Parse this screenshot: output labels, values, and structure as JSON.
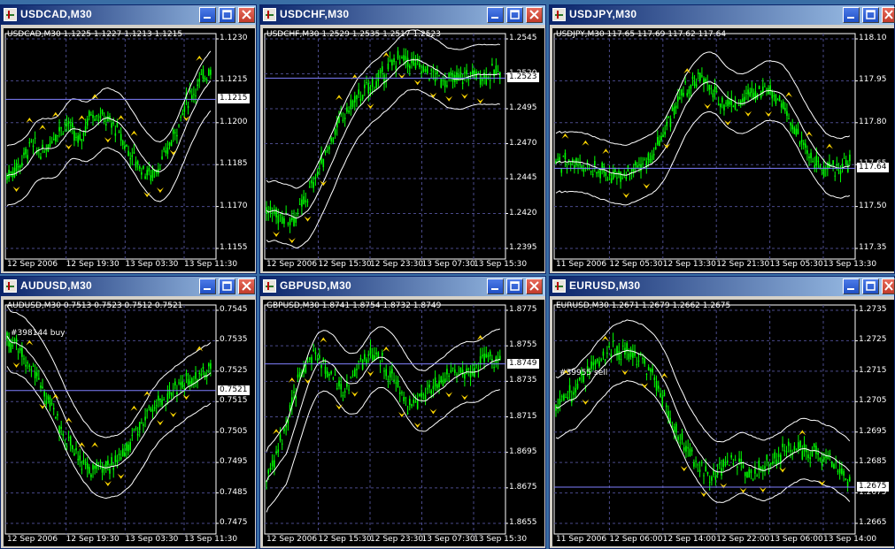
{
  "colors": {
    "background": "#000000",
    "candle": "#00ff00",
    "band": "#ffffff",
    "grid": "#4a4a8a",
    "fractal": "#ffd700",
    "title_bar": "#0a246a"
  },
  "windows": [
    {
      "title": "USDCAD,M30",
      "header": "USDCAD,M30  1.1225 1.1227 1.1213 1.1215",
      "price": "1.1215",
      "note": "",
      "yticks": [
        "1.1230",
        "1.1215",
        "1.1200",
        "1.1185",
        "1.1170",
        "1.1155"
      ],
      "xticks": [
        "12 Sep 2006",
        "12 Sep 19:30",
        "13 Sep 03:30",
        "13 Sep 11:30"
      ],
      "chart_data": {
        "type": "candlestick",
        "symbol": "USDCAD",
        "timeframe": "M30",
        "ylim": [
          1.1147,
          1.1243
        ],
        "last": 1.1215,
        "bar_count": 110
      }
    },
    {
      "title": "USDCHF,M30",
      "header": "USDCHF,M30  1.2529 1.2535 1.2517 1.2523",
      "price": "1.2523",
      "note": "",
      "yticks": [
        "1.2545",
        "1.2520",
        "1.2495",
        "1.2470",
        "1.2445",
        "1.2420",
        "1.2395"
      ],
      "xticks": [
        "12 Sep 2006",
        "12 Sep 15:30",
        "12 Sep 23:30",
        "13 Sep 07:30",
        "13 Sep 15:30"
      ],
      "chart_data": {
        "type": "candlestick",
        "symbol": "USDCHF",
        "timeframe": "M30",
        "ylim": [
          1.2385,
          1.2557
        ],
        "last": 1.2523,
        "bar_count": 120
      }
    },
    {
      "title": "USDJPY,M30",
      "header": "USDJPY,M30  117.65 117.69 117.62 117.64",
      "price": "117.64",
      "note": "",
      "yticks": [
        "118.10",
        "117.95",
        "117.80",
        "117.65",
        "117.50",
        "117.35"
      ],
      "xticks": [
        "11 Sep 2006",
        "12 Sep 05:30",
        "12 Sep 13:30",
        "12 Sep 21:30",
        "13 Sep 05:30",
        "13 Sep 13:30"
      ],
      "chart_data": {
        "type": "candlestick",
        "symbol": "USDJPY",
        "timeframe": "M30",
        "ylim": [
          117.29,
          118.16
        ],
        "last": 117.64,
        "bar_count": 160
      }
    },
    {
      "title": "AUDUSD,M30",
      "header": "AUDUSD,M30  0.7513 0.7523 0.7512 0.7521",
      "price": "0.7521",
      "note": "#398144 buy",
      "yticks": [
        "0.7545",
        "0.7535",
        "0.7525",
        "0.7515",
        "0.7505",
        "0.7495",
        "0.7485",
        "0.7475"
      ],
      "xticks": [
        "12 Sep 2006",
        "12 Sep 19:30",
        "13 Sep 03:30",
        "13 Sep 11:30"
      ],
      "chart_data": {
        "type": "candlestick",
        "symbol": "AUDUSD",
        "timeframe": "M30",
        "ylim": [
          0.7469,
          0.7552
        ],
        "last": 0.7521,
        "bar_count": 110
      }
    },
    {
      "title": "GBPUSD,M30",
      "header": "GBPUSD,M30  1.8741 1.8754 1.8732 1.8749",
      "price": "1.8749",
      "note": "",
      "yticks": [
        "1.8775",
        "1.8755",
        "1.8735",
        "1.8715",
        "1.8695",
        "1.8675",
        "1.8655"
      ],
      "xticks": [
        "12 Sep 2006",
        "12 Sep 15:30",
        "12 Sep 23:30",
        "13 Sep 07:30",
        "13 Sep 15:30"
      ],
      "chart_data": {
        "type": "candlestick",
        "symbol": "GBPUSD",
        "timeframe": "M30",
        "ylim": [
          1.8645,
          1.8785
        ],
        "last": 1.8749,
        "bar_count": 120
      }
    },
    {
      "title": "EURUSD,M30",
      "header": "EURUSD,M30  1.2671 1.2679 1.2662 1.2675",
      "price": "1.2675",
      "note": "#39955 sell",
      "yticks": [
        "1.2735",
        "1.2725",
        "1.2715",
        "1.2705",
        "1.2695",
        "1.2685",
        "1.2675",
        "1.2665"
      ],
      "xticks": [
        "11 Sep 2006",
        "12 Sep 06:00",
        "12 Sep 14:00",
        "12 Sep 22:00",
        "13 Sep 06:00",
        "13 Sep 14:00"
      ],
      "chart_data": {
        "type": "candlestick",
        "symbol": "EURUSD",
        "timeframe": "M30",
        "ylim": [
          1.2658,
          1.2741
        ],
        "last": 1.2675,
        "bar_count": 150
      }
    }
  ]
}
